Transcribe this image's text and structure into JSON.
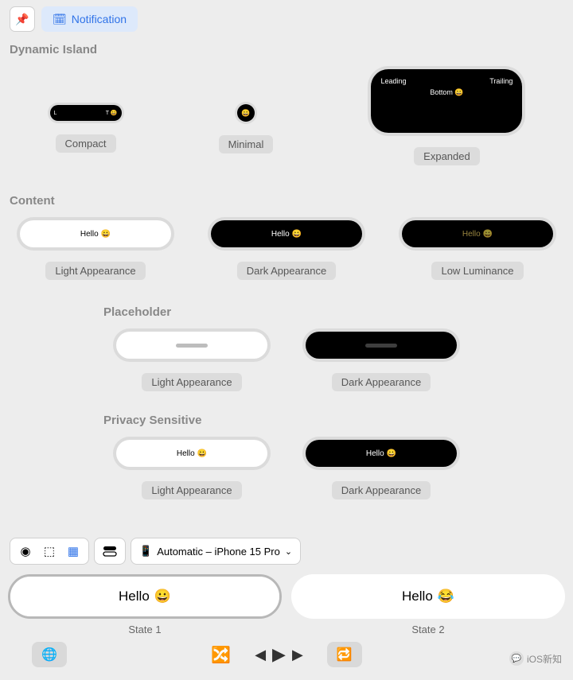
{
  "toolbar": {
    "notification_label": "Notification"
  },
  "sections": {
    "dynamic_island": "Dynamic Island",
    "content": "Content",
    "placeholder": "Placeholder",
    "privacy": "Privacy Sensitive"
  },
  "dynamic_island": {
    "compact": {
      "l": "L",
      "t": "T",
      "label": "Compact",
      "emoji": "😀"
    },
    "minimal": {
      "label": "Minimal",
      "emoji": "😀"
    },
    "expanded": {
      "leading": "Leading",
      "trailing": "Trailing",
      "bottom": "Bottom 😀",
      "label": "Expanded"
    }
  },
  "content": {
    "hello": "Hello",
    "emoji": "😀",
    "light": "Light Appearance",
    "dark": "Dark Appearance",
    "low": "Low Luminance"
  },
  "placeholder": {
    "light": "Light Appearance",
    "dark": "Dark Appearance"
  },
  "privacy": {
    "hello": "Hello",
    "emoji": "😀",
    "light": "Light Appearance",
    "dark": "Dark Appearance"
  },
  "device_picker": "Automatic – iPhone 15 Pro",
  "states": {
    "hello": "Hello",
    "emoji1": "😀",
    "emoji2": "😂",
    "state1": "State 1",
    "state2": "State 2"
  },
  "watermark": "iOS新知"
}
